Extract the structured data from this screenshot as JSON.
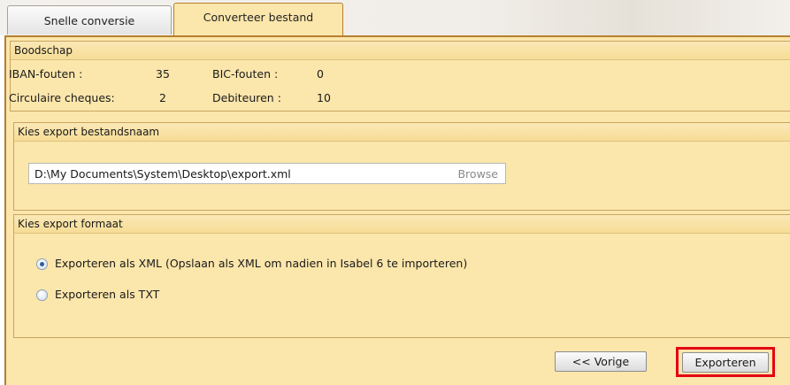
{
  "tabs": [
    {
      "label": "Snelle conversie",
      "active": false
    },
    {
      "label": "Converteer bestand",
      "active": true
    }
  ],
  "message": {
    "header": "Boodschap",
    "iban_label": "IBAN-fouten :",
    "iban_value": "35",
    "bic_label": "BIC-fouten :",
    "bic_value": "0",
    "cheques_label": "Circulaire cheques:",
    "cheques_value": "2",
    "debtors_label": "Debiteuren :",
    "debtors_value": "10"
  },
  "filename": {
    "header": "Kies export bestandsnaam",
    "path_value": "D:\\My Documents\\System\\Desktop\\export.xml",
    "browse_label": "Browse"
  },
  "format": {
    "header": "Kies export formaat",
    "options": [
      {
        "label": "Exporteren als XML  (Opslaan als XML om nadien in Isabel 6 te importeren)",
        "selected": true
      },
      {
        "label": "Exporteren als TXT",
        "selected": false
      }
    ]
  },
  "buttons": {
    "prev_label": "<< Vorige",
    "export_label": "Exporteren"
  },
  "colors": {
    "panel_bg": "#fbe6ab",
    "highlight": "#e30613"
  }
}
